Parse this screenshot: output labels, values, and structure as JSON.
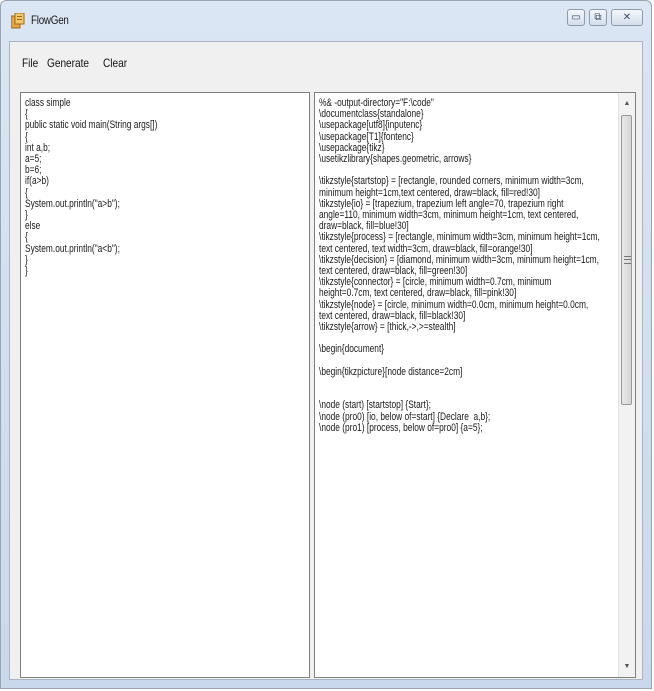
{
  "window": {
    "title": "FlowGen",
    "controls": {
      "minimize": "▭",
      "maximize": "⧉",
      "close": "✕"
    }
  },
  "menu": {
    "items": [
      {
        "id": "file",
        "label": "File"
      },
      {
        "id": "generate",
        "label": "Generate"
      },
      {
        "id": "clear",
        "label": "Clear"
      }
    ]
  },
  "editor": {
    "source_code": "class simple\n{\npublic static void main(String args[])\n{\nint a,b;\na=5;\nb=6;\nif(a>b)\n{\nSystem.out.println(\"a>b\");\n}\nelse\n{\nSystem.out.println(\"a<b\");\n}\n}"
  },
  "output": {
    "latex_code": "%& -output-directory=\"F:\\code\"\n\\documentclass{standalone}\n\\usepackage[utf8]{inputenc}\n\\usepackage[T1]{fontenc}\n\\usepackage{tikz}\n\\usetikzlibrary{shapes.geometric, arrows}\n\n\\tikzstyle{startstop} = [rectangle, rounded corners, minimum width=3cm, minimum height=1cm,text centered, draw=black, fill=red!30]\n\\tikzstyle{io} = [trapezium, trapezium left angle=70, trapezium right angle=110, minimum width=3cm, minimum height=1cm, text centered, draw=black, fill=blue!30]\n\\tikzstyle{process} = [rectangle, minimum width=3cm, minimum height=1cm, text centered, text width=3cm, draw=black, fill=orange!30]\n\\tikzstyle{decision} = [diamond, minimum width=3cm, minimum height=1cm, text centered, draw=black, fill=green!30]\n\\tikzstyle{connector} = [circle, minimum width=0.7cm, minimum height=0.7cm, text centered, draw=black, fill=pink!30]\n\\tikzstyle{node} = [circle, minimum width=0.0cm, minimum height=0.0cm, text centered, draw=black, fill=black!30]\n\\tikzstyle{arrow} = [thick,->,>=stealth]\n\n\\begin{document}\n\n\\begin{tikzpicture}[node distance=2cm]\n\n\n\\node (start) [startstop] {Start};\n\\node (pro0) [io, below of=start] {Declare  a,b};\n\\node (pro1) [process, below of=pro0] {a=5};"
  },
  "colors": {
    "titlebar": "#c9d8ec",
    "client": "#f0f0f0",
    "text": "#1a1a1a"
  }
}
